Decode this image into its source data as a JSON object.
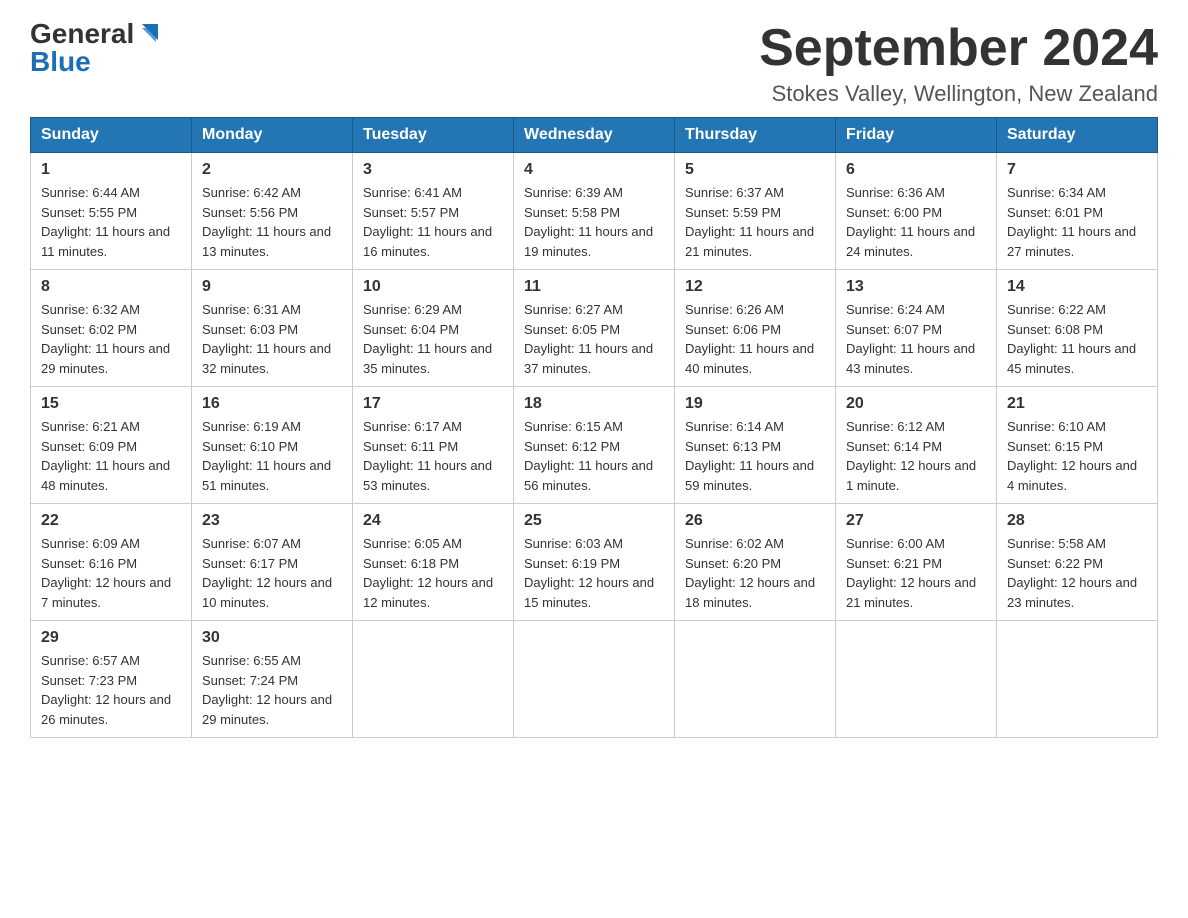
{
  "header": {
    "logo_line1": "General",
    "logo_line2": "Blue",
    "month_title": "September 2024",
    "location": "Stokes Valley, Wellington, New Zealand"
  },
  "days_of_week": [
    "Sunday",
    "Monday",
    "Tuesday",
    "Wednesday",
    "Thursday",
    "Friday",
    "Saturday"
  ],
  "weeks": [
    [
      {
        "day": "1",
        "sunrise": "6:44 AM",
        "sunset": "5:55 PM",
        "daylight": "11 hours and 11 minutes."
      },
      {
        "day": "2",
        "sunrise": "6:42 AM",
        "sunset": "5:56 PM",
        "daylight": "11 hours and 13 minutes."
      },
      {
        "day": "3",
        "sunrise": "6:41 AM",
        "sunset": "5:57 PM",
        "daylight": "11 hours and 16 minutes."
      },
      {
        "day": "4",
        "sunrise": "6:39 AM",
        "sunset": "5:58 PM",
        "daylight": "11 hours and 19 minutes."
      },
      {
        "day": "5",
        "sunrise": "6:37 AM",
        "sunset": "5:59 PM",
        "daylight": "11 hours and 21 minutes."
      },
      {
        "day": "6",
        "sunrise": "6:36 AM",
        "sunset": "6:00 PM",
        "daylight": "11 hours and 24 minutes."
      },
      {
        "day": "7",
        "sunrise": "6:34 AM",
        "sunset": "6:01 PM",
        "daylight": "11 hours and 27 minutes."
      }
    ],
    [
      {
        "day": "8",
        "sunrise": "6:32 AM",
        "sunset": "6:02 PM",
        "daylight": "11 hours and 29 minutes."
      },
      {
        "day": "9",
        "sunrise": "6:31 AM",
        "sunset": "6:03 PM",
        "daylight": "11 hours and 32 minutes."
      },
      {
        "day": "10",
        "sunrise": "6:29 AM",
        "sunset": "6:04 PM",
        "daylight": "11 hours and 35 minutes."
      },
      {
        "day": "11",
        "sunrise": "6:27 AM",
        "sunset": "6:05 PM",
        "daylight": "11 hours and 37 minutes."
      },
      {
        "day": "12",
        "sunrise": "6:26 AM",
        "sunset": "6:06 PM",
        "daylight": "11 hours and 40 minutes."
      },
      {
        "day": "13",
        "sunrise": "6:24 AM",
        "sunset": "6:07 PM",
        "daylight": "11 hours and 43 minutes."
      },
      {
        "day": "14",
        "sunrise": "6:22 AM",
        "sunset": "6:08 PM",
        "daylight": "11 hours and 45 minutes."
      }
    ],
    [
      {
        "day": "15",
        "sunrise": "6:21 AM",
        "sunset": "6:09 PM",
        "daylight": "11 hours and 48 minutes."
      },
      {
        "day": "16",
        "sunrise": "6:19 AM",
        "sunset": "6:10 PM",
        "daylight": "11 hours and 51 minutes."
      },
      {
        "day": "17",
        "sunrise": "6:17 AM",
        "sunset": "6:11 PM",
        "daylight": "11 hours and 53 minutes."
      },
      {
        "day": "18",
        "sunrise": "6:15 AM",
        "sunset": "6:12 PM",
        "daylight": "11 hours and 56 minutes."
      },
      {
        "day": "19",
        "sunrise": "6:14 AM",
        "sunset": "6:13 PM",
        "daylight": "11 hours and 59 minutes."
      },
      {
        "day": "20",
        "sunrise": "6:12 AM",
        "sunset": "6:14 PM",
        "daylight": "12 hours and 1 minute."
      },
      {
        "day": "21",
        "sunrise": "6:10 AM",
        "sunset": "6:15 PM",
        "daylight": "12 hours and 4 minutes."
      }
    ],
    [
      {
        "day": "22",
        "sunrise": "6:09 AM",
        "sunset": "6:16 PM",
        "daylight": "12 hours and 7 minutes."
      },
      {
        "day": "23",
        "sunrise": "6:07 AM",
        "sunset": "6:17 PM",
        "daylight": "12 hours and 10 minutes."
      },
      {
        "day": "24",
        "sunrise": "6:05 AM",
        "sunset": "6:18 PM",
        "daylight": "12 hours and 12 minutes."
      },
      {
        "day": "25",
        "sunrise": "6:03 AM",
        "sunset": "6:19 PM",
        "daylight": "12 hours and 15 minutes."
      },
      {
        "day": "26",
        "sunrise": "6:02 AM",
        "sunset": "6:20 PM",
        "daylight": "12 hours and 18 minutes."
      },
      {
        "day": "27",
        "sunrise": "6:00 AM",
        "sunset": "6:21 PM",
        "daylight": "12 hours and 21 minutes."
      },
      {
        "day": "28",
        "sunrise": "5:58 AM",
        "sunset": "6:22 PM",
        "daylight": "12 hours and 23 minutes."
      }
    ],
    [
      {
        "day": "29",
        "sunrise": "6:57 AM",
        "sunset": "7:23 PM",
        "daylight": "12 hours and 26 minutes."
      },
      {
        "day": "30",
        "sunrise": "6:55 AM",
        "sunset": "7:24 PM",
        "daylight": "12 hours and 29 minutes."
      },
      null,
      null,
      null,
      null,
      null
    ]
  ],
  "labels": {
    "sunrise": "Sunrise:",
    "sunset": "Sunset:",
    "daylight": "Daylight:"
  }
}
